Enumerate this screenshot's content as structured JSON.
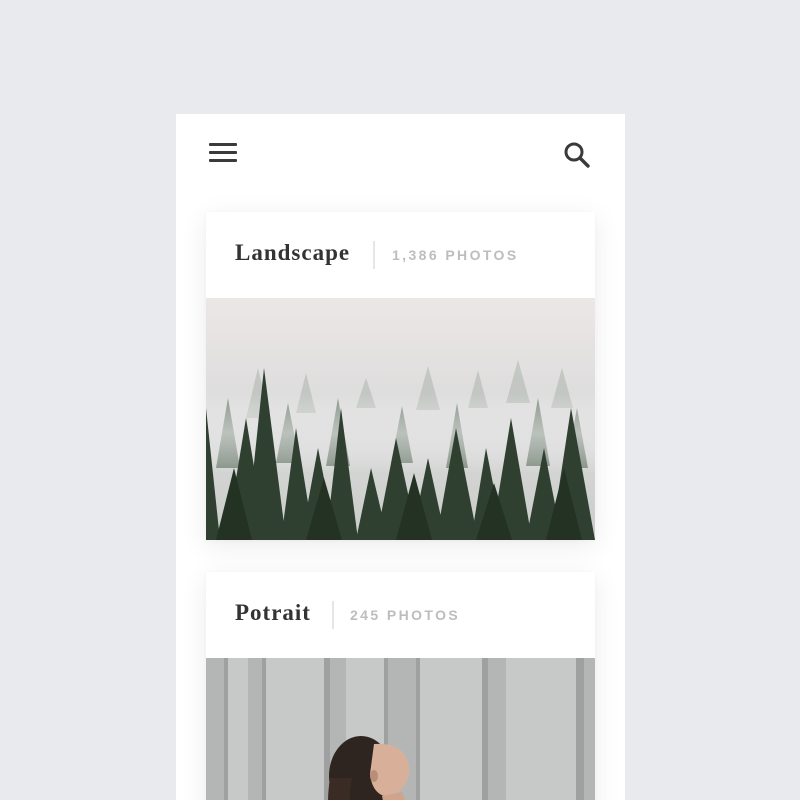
{
  "header": {
    "menu_icon": "hamburger-menu-icon",
    "search_icon": "search-icon"
  },
  "albums": [
    {
      "title": "Landscape",
      "count": "1,386 PHOTOS",
      "image": "misty-pine-forest-photo"
    },
    {
      "title": "Potrait",
      "count": "245 PHOTOS",
      "image": "woman-portrait-photo"
    }
  ],
  "colors": {
    "background": "#e9eaee",
    "surface": "#ffffff",
    "title": "#333333",
    "muted": "#bdbdbd",
    "icon": "#3a3a3a"
  }
}
